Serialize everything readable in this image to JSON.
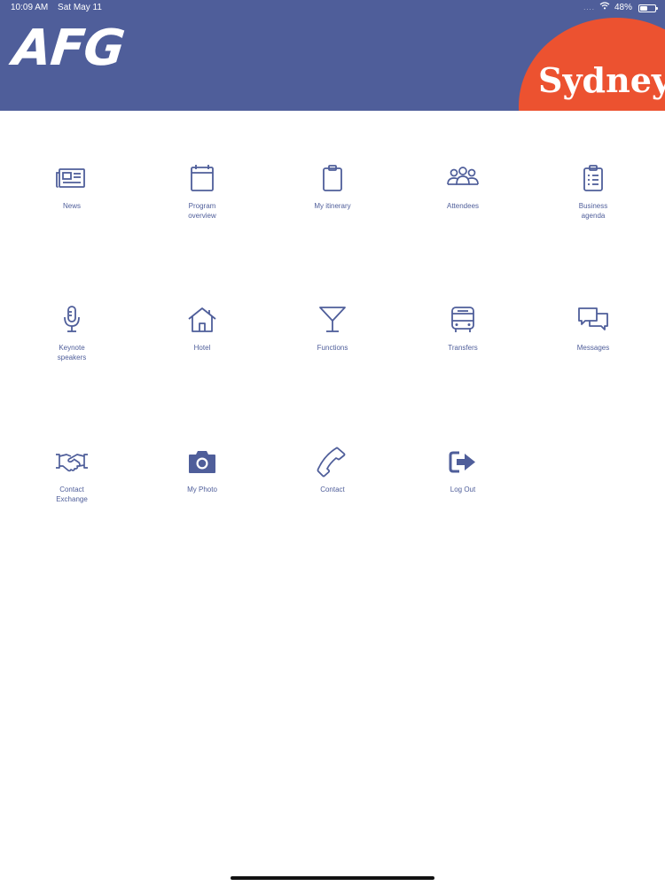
{
  "status_bar": {
    "time": "10:09 AM",
    "date": "Sat May 11",
    "signal": "....",
    "battery_percent": "48%",
    "battery_level": 0.48
  },
  "header": {
    "logo": "AFG",
    "city": "Sydney",
    "colors": {
      "header_bg": "#4f5e9a",
      "badge_bg": "#ec5230"
    }
  },
  "menu": [
    {
      "label": "News",
      "icon": "newspaper-icon"
    },
    {
      "label": "Program\noverview",
      "icon": "calendar-icon"
    },
    {
      "label": "My itinerary",
      "icon": "clipboard-icon"
    },
    {
      "label": "Attendees",
      "icon": "users-icon"
    },
    {
      "label": "Business\nagenda",
      "icon": "checklist-icon"
    },
    {
      "label": "Keynote\nspeakers",
      "icon": "microphone-icon"
    },
    {
      "label": "Hotel",
      "icon": "home-icon"
    },
    {
      "label": "Functions",
      "icon": "cocktail-icon"
    },
    {
      "label": "Transfers",
      "icon": "bus-icon"
    },
    {
      "label": "Messages",
      "icon": "chat-icon"
    },
    {
      "label": "Contact\nExchange",
      "icon": "handshake-icon"
    },
    {
      "label": "My Photo",
      "icon": "camera-icon"
    },
    {
      "label": "Contact",
      "icon": "phone-icon"
    },
    {
      "label": "Log Out",
      "icon": "logout-icon"
    }
  ]
}
